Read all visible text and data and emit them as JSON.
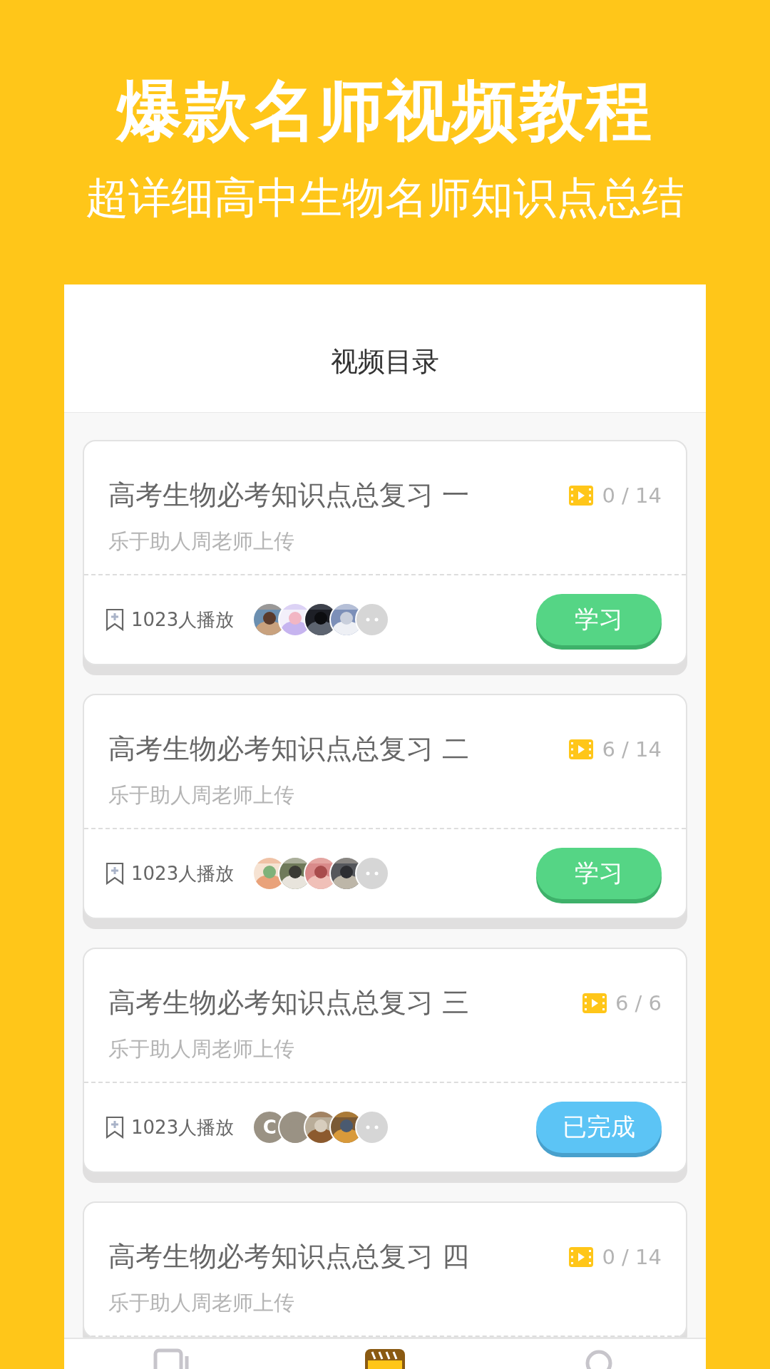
{
  "hero": {
    "title": "爆款名师视频教程",
    "subtitle": "超详细高中生物名师知识点总结"
  },
  "panel": {
    "title": "视频目录"
  },
  "courses": [
    {
      "title": "高考生物必考知识点总复习 一",
      "progress": "0 / 14",
      "uploader": "乐于助人周老师上传",
      "plays": "1023人播放",
      "avatars": [
        {
          "kind": "picture"
        },
        {
          "kind": "picture"
        },
        {
          "kind": "picture"
        },
        {
          "kind": "picture"
        },
        {
          "kind": "more"
        }
      ],
      "completed": false,
      "button": "学习"
    },
    {
      "title": "高考生物必考知识点总复习 二",
      "progress": "6 / 14",
      "uploader": "乐于助人周老师上传",
      "plays": "1023人播放",
      "avatars": [
        {
          "kind": "picture"
        },
        {
          "kind": "picture"
        },
        {
          "kind": "picture"
        },
        {
          "kind": "picture"
        },
        {
          "kind": "more"
        }
      ],
      "completed": false,
      "button": "学习"
    },
    {
      "title": "高考生物必考知识点总复习 三",
      "progress": "6 / 6",
      "uploader": "乐于助人周老师上传",
      "plays": "1023人播放",
      "avatars": [
        {
          "kind": "letter",
          "text": "C"
        },
        {
          "kind": "picture"
        },
        {
          "kind": "picture"
        },
        {
          "kind": "picture"
        },
        {
          "kind": "more"
        }
      ],
      "completed": true,
      "button": "已完成"
    },
    {
      "title": "高考生物必考知识点总复习 四",
      "progress": "0 / 14",
      "uploader": "乐于助人周老师上传"
    }
  ],
  "nav": [
    {
      "selected": false
    },
    {
      "selected": true
    },
    {
      "selected": false
    }
  ]
}
